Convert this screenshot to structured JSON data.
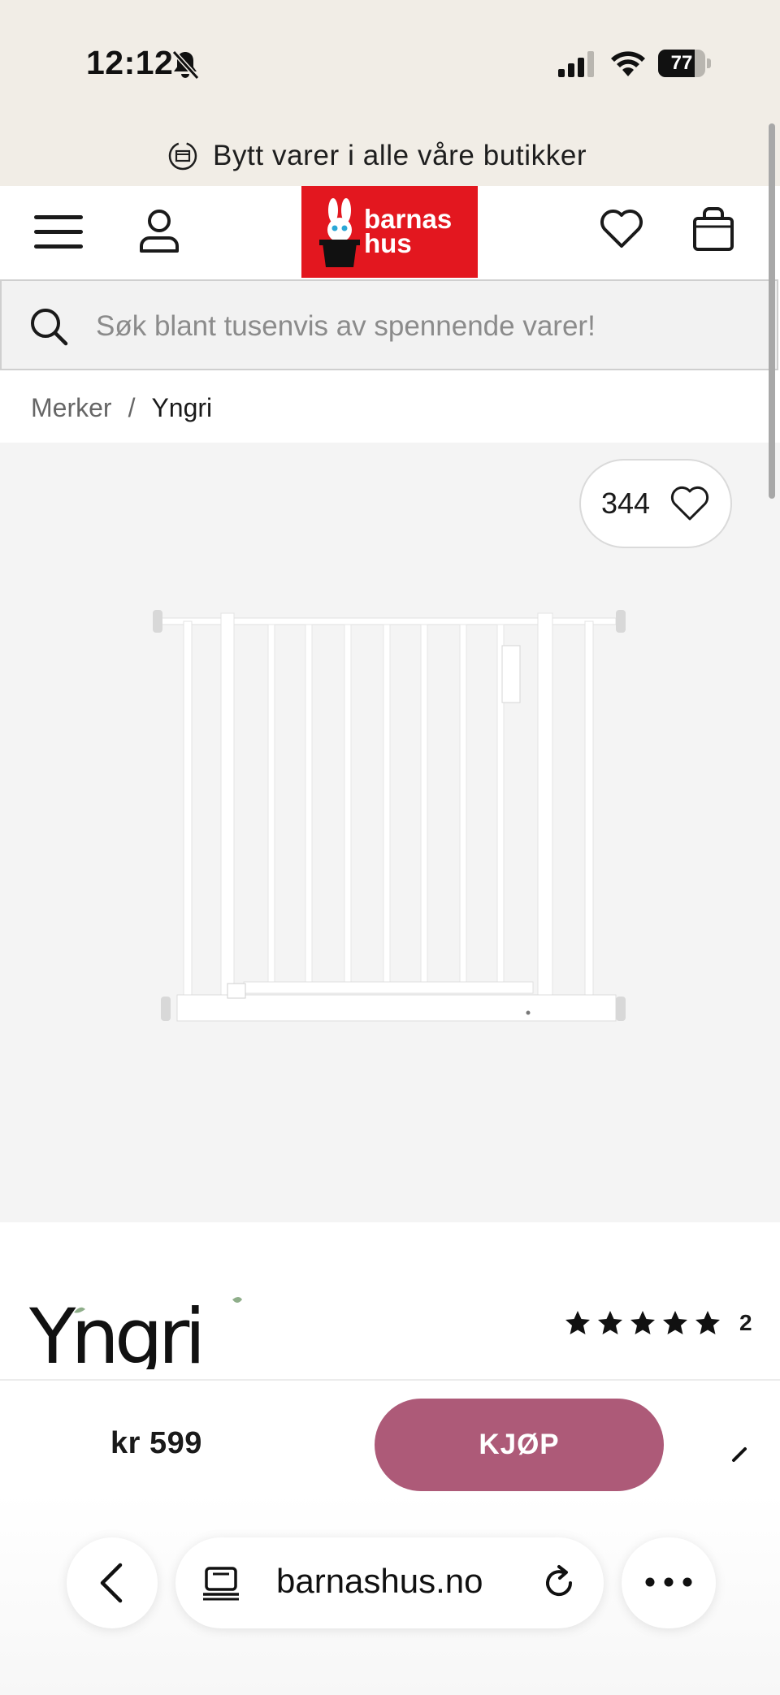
{
  "status_bar": {
    "time": "12:12",
    "battery_percent": "77",
    "battery_level": 0.77,
    "icons": [
      "bell-slash-icon",
      "signal-icon",
      "wifi-icon",
      "battery-icon"
    ]
  },
  "promo_banner": {
    "text": "Bytt varer i alle våre butikker",
    "icon": "exchange-box-icon"
  },
  "header": {
    "logo_text_line1": "barnas",
    "logo_text_line2": "hus",
    "brand_color": "#e3171f",
    "icons": [
      "menu-icon",
      "account-icon",
      "heart-icon",
      "bag-icon"
    ]
  },
  "search": {
    "placeholder": "Søk blant tusenvis av spennende varer!",
    "value": ""
  },
  "breadcrumb": {
    "items": [
      "Merker",
      "Yngri"
    ],
    "separator": "/"
  },
  "product": {
    "favorites_count": "344",
    "brand_logo_text": "Yngri",
    "rating_stars": 5,
    "review_count": "2"
  },
  "buy_bar": {
    "price": "kr 599",
    "buy_label": "KJØP",
    "buy_color": "#ad5a78"
  },
  "browser": {
    "url": "barnashus.no",
    "icons": [
      "back-icon",
      "reader-icon",
      "reload-icon",
      "more-icon"
    ]
  }
}
